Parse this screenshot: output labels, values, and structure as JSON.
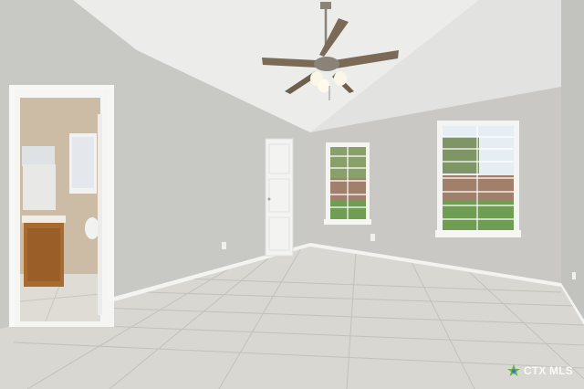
{
  "photo": {
    "subject": "empty-bedroom",
    "colors": {
      "wall": "#c9c9c6",
      "wall_shadow": "#b9b9b5",
      "ceiling": "#eaeaea",
      "floor": "#d8d7d2",
      "grout": "#c3c2bc",
      "trim": "#f4f4f2",
      "door": "#f3f3f1",
      "bath_wall": "#cdbca6",
      "cabinet": "#a86a2e",
      "lawn": "#6f9e52",
      "fence": "#a0806a",
      "sky": "#cfe0ee",
      "fan_blade": "#7b6a55",
      "fan_metal": "#8a8378"
    }
  },
  "watermark": {
    "brand": "CTX MLS",
    "logo_icon": "ctxmls-logo-icon"
  }
}
